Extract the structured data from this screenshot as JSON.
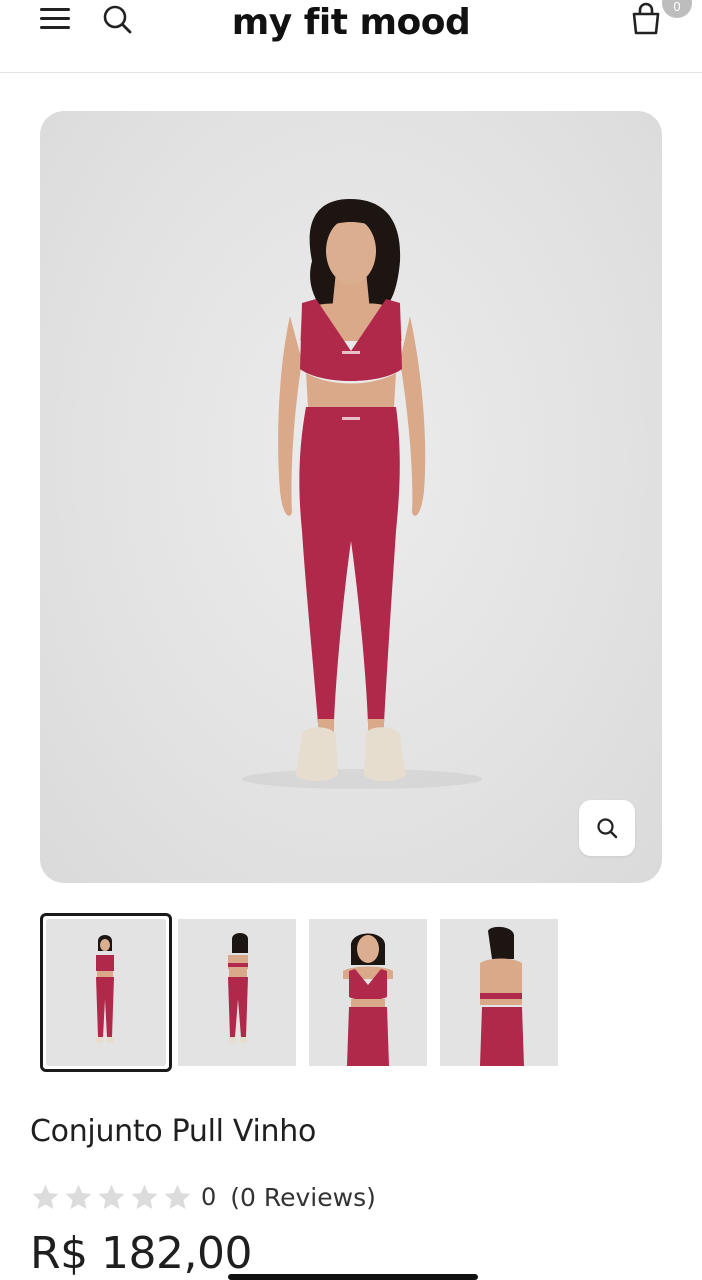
{
  "header": {
    "logo": "my fit mood",
    "cart_count": "0"
  },
  "product": {
    "title": "Conjunto Pull Vinho",
    "rating_count": "0",
    "reviews_label": "(0 Reviews)",
    "price": "R$ 182,00",
    "stars_total": 5,
    "stars_filled": 0
  },
  "gallery": {
    "thumbnails": [
      "front-full",
      "back-full",
      "front-closeup",
      "back-closeup"
    ],
    "active_index": 0
  },
  "icons": {
    "menu": "hamburger-icon",
    "search": "search-icon",
    "cart": "shopping-bag-icon",
    "zoom": "zoom-icon",
    "star": "star-icon"
  },
  "colors": {
    "garment": "#b0284a",
    "star_empty": "#dcdcdc",
    "badge": "#bdbdbd"
  }
}
